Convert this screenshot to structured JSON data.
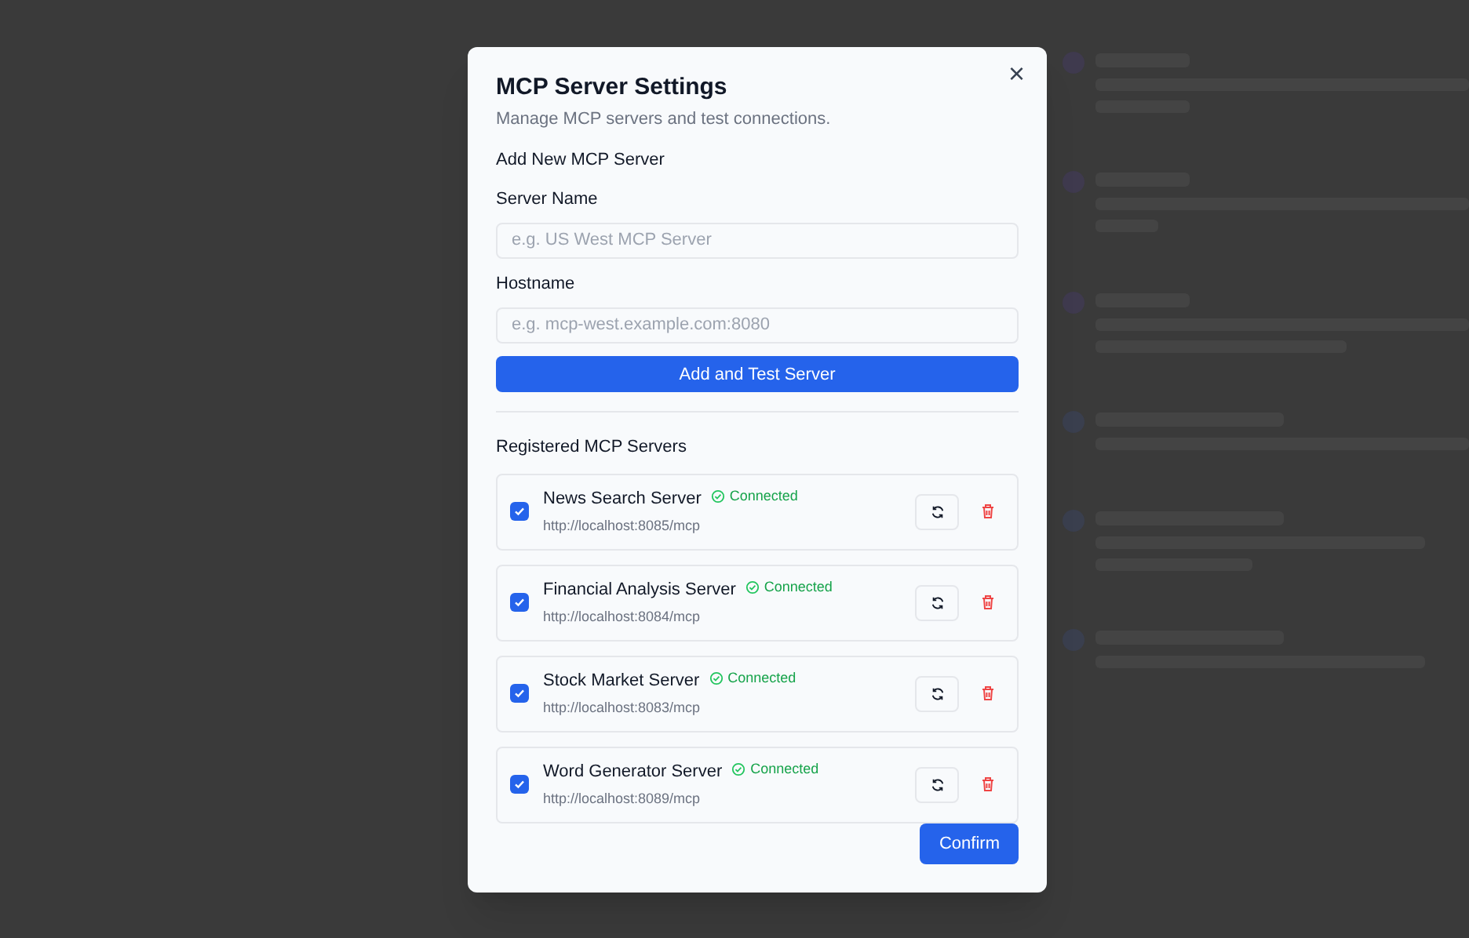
{
  "dialog": {
    "title": "MCP Server Settings",
    "description": "Manage MCP servers and test connections.",
    "close": "×",
    "add_section": {
      "heading": "Add New MCP Server",
      "fields": [
        {
          "label": "Server Name",
          "placeholder": "e.g. US West MCP Server"
        },
        {
          "label": "Hostname",
          "placeholder": "e.g. mcp-west.example.com:8080"
        }
      ],
      "button": "Add and Test Server"
    },
    "registered_heading": "Registered MCP Servers",
    "servers": [
      {
        "name": "News Search Server",
        "status": "Connected",
        "url": "http://localhost:8085/mcp",
        "checked": true
      },
      {
        "name": "Financial Analysis Server",
        "status": "Connected",
        "url": "http://localhost:8084/mcp",
        "checked": true
      },
      {
        "name": "Stock Market Server",
        "status": "Connected",
        "url": "http://localhost:8083/mcp",
        "checked": true
      },
      {
        "name": "Word Generator Server",
        "status": "Connected",
        "url": "http://localhost:8089/mcp",
        "checked": true
      }
    ],
    "confirm": "Confirm"
  }
}
